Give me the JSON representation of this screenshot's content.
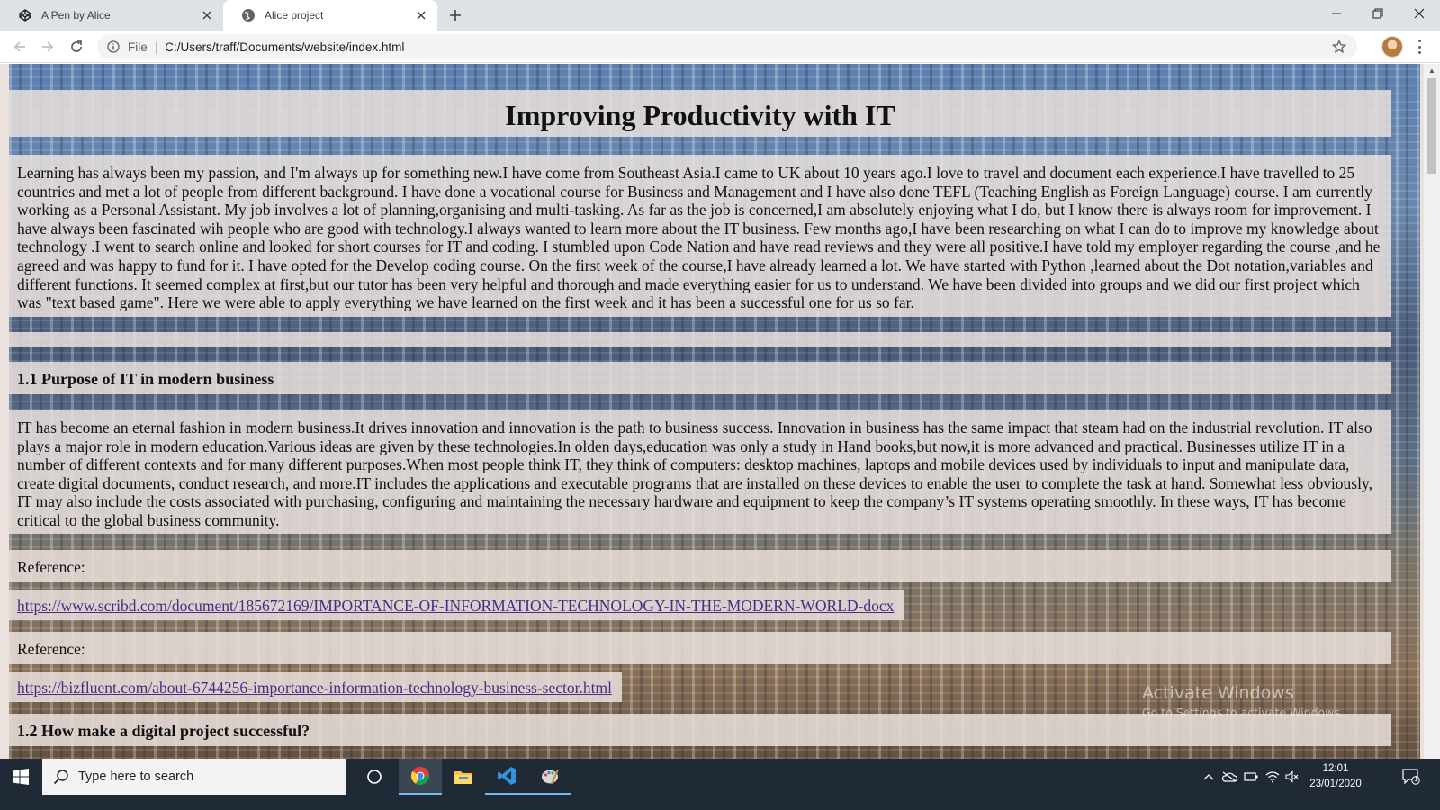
{
  "browser": {
    "tabs": [
      {
        "title": "A Pen by Alice",
        "icon": "codepen-icon",
        "active": false
      },
      {
        "title": "Alice project",
        "icon": "globe-icon",
        "active": true
      }
    ],
    "scheme_label": "File",
    "url": "C:/Users/traff/Documents/website/index.html"
  },
  "page": {
    "heading": "Improving Productivity with IT",
    "intro": "Learning has always been my passion, and I'm always up for something new.I have come from Southeast Asia.I came to UK about 10 years ago.I love to travel and document each experience.I have travelled to 25 countries and met a lot of people from different background. I have done a vocational course for Business and Management and I have also done TEFL (Teaching English as Foreign Language) course. I am currently working as a Personal Assistant. My job involves a lot of planning,organising and multi-tasking. As far as the job is concerned,I am absolutely enjoying what I do, but I know there is always room for improvement. I have always been fascinated wih people who are good with technology.I always wanted to learn more about the IT business. Few months ago,I have been researching on what I can do to improve my knowledge about technology .I went to search online and looked for short courses for IT and coding. I stumbled upon Code Nation and have read reviews and they were all positive.I have told my employer regarding the course ,and he agreed and was happy to fund for it. I have opted for the Develop coding course. On the first week of the course,I have already learned a lot. We have started with Python ,learned about the Dot notation,variables and different functions. It seemed complex at first,but our tutor has been very helpful and thorough and made everything easier for us to understand. We have been divided into groups and we did our first project which was \"text based game\". Here we were able to apply everything we have learned on the first week and it has been a successful one for us so far.",
    "section1_heading": "1.1 Purpose of IT in modern business",
    "section1_text": "IT has become an eternal fashion in modern business.It drives innovation and innovation is the path to business success. Innovation in business has the same impact that steam had on the industrial revolution. IT also plays a major role in modern education.Various ideas are given by these technologies.In olden days,education was only a study in Hand books,but now,it is more advanced and practical. Businesses utilize IT in a number of different contexts and for many different purposes.When most people think IT, they think of computers: desktop machines, laptops and mobile devices used by individuals to input and manipulate data, create digital documents, conduct research, and more.IT includes the applications and executable programs that are installed on these devices to enable the user to complete the task at hand. Somewhat less obviously, IT may also include the costs associated with purchasing, configuring and maintaining the necessary hardware and equipment to keep the company’s IT systems operating smoothly. In these ways, IT has become critical to the global business community.",
    "reference_label_1": "Reference:",
    "reference_link_1": "https://www.scribd.com/document/185672169/IMPORTANCE-OF-INFORMATION-TECHNOLOGY-IN-THE-MODERN-WORLD-docx",
    "reference_label_2": "Reference:",
    "reference_link_2": "https://bizfluent.com/about-6744256-importance-information-technology-business-sector.html",
    "section2_heading": "1.2 How make a digital project successful?"
  },
  "watermark": {
    "line1": "Activate Windows",
    "line2": "Go to Settings to activate Windows."
  },
  "taskbar": {
    "search_placeholder": "Type here to search",
    "time": "12:01",
    "date": "23/01/2020",
    "notification_count": "1",
    "apps": [
      "task-view-icon",
      "chrome-icon",
      "file-explorer-icon",
      "vscode-icon",
      "paint-icon"
    ]
  },
  "colors": {
    "tabstrip": "#dee1e6",
    "panel": "#e9e0dc",
    "link": "#4b2a86",
    "taskbar": "#1f2a36"
  }
}
